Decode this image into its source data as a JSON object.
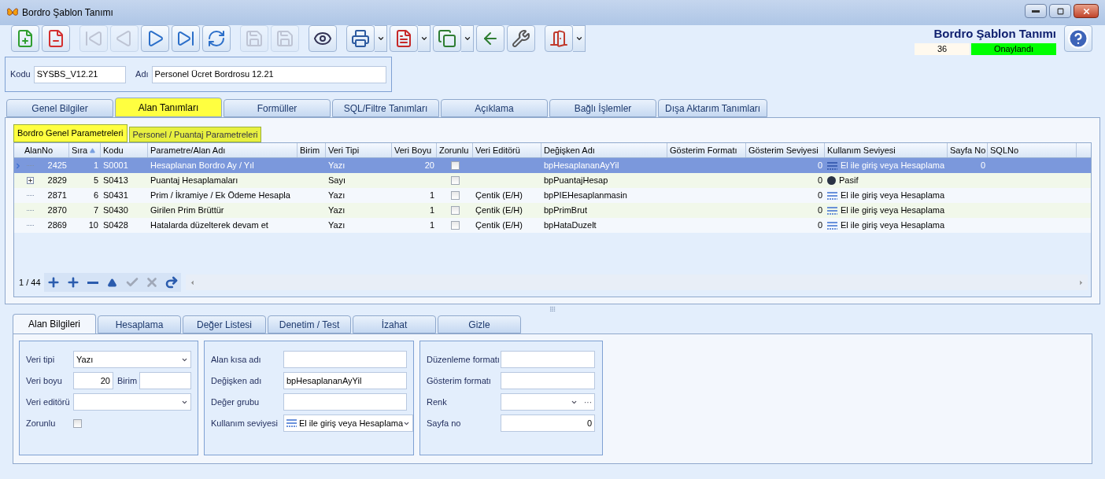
{
  "window": {
    "title": "Bordro Şablon Tanımı"
  },
  "toolbar": [
    {
      "kind": "new",
      "disabled": false,
      "dropdown": false
    },
    {
      "kind": "delete",
      "disabled": false,
      "dropdown": false
    },
    {
      "kind": "first",
      "disabled": true,
      "dropdown": false
    },
    {
      "kind": "prev",
      "disabled": true,
      "dropdown": false
    },
    {
      "kind": "next",
      "disabled": false,
      "dropdown": false
    },
    {
      "kind": "last",
      "disabled": false,
      "dropdown": false
    },
    {
      "kind": "refresh",
      "disabled": false,
      "dropdown": false
    },
    {
      "kind": "save",
      "disabled": true,
      "dropdown": false
    },
    {
      "kind": "cancel",
      "disabled": true,
      "dropdown": false
    },
    {
      "kind": "preview",
      "disabled": false,
      "dropdown": false
    },
    {
      "kind": "print",
      "disabled": false,
      "dropdown": true
    },
    {
      "kind": "pdf",
      "disabled": false,
      "dropdown": true
    },
    {
      "kind": "export",
      "disabled": false,
      "dropdown": true
    },
    {
      "kind": "import",
      "disabled": false,
      "dropdown": false
    },
    {
      "kind": "tools",
      "disabled": false,
      "dropdown": false
    },
    {
      "kind": "exit",
      "disabled": false,
      "dropdown": true
    }
  ],
  "header": {
    "title": "Bordro Şablon Tanımı",
    "number": "36",
    "status": "Onaylandı"
  },
  "form": {
    "kodu_label": "Kodu",
    "kodu": "SYSBS_V12.21",
    "adi_label": "Adı",
    "adi": "Personel Ücret Bordrosu 12.21"
  },
  "main_tabs": [
    {
      "label": "Genel Bilgiler",
      "selected": false
    },
    {
      "label": "Alan Tanımları",
      "selected": true
    },
    {
      "label": "Formüller",
      "selected": false
    },
    {
      "label": "SQL/Filtre Tanımları",
      "selected": false
    },
    {
      "label": "Açıklama",
      "selected": false
    },
    {
      "label": "Bağlı İşlemler",
      "selected": false
    },
    {
      "label": "Dışa Aktarım Tanımları",
      "selected": false
    }
  ],
  "sub_tabs": [
    {
      "label": "Bordro Genel Parametreleri",
      "selected": true
    },
    {
      "label": "Personel / Puantaj Parametreleri",
      "selected": false
    }
  ],
  "grid": {
    "columns": [
      "AlanNo",
      "Sıra",
      "Kodu",
      "Parametre/Alan Adı",
      "Birim",
      "Veri Tipi",
      "Veri Boyu",
      "Zorunlu",
      "Veri Editörü",
      "Değişken Adı",
      "Gösterim Formatı",
      "Gösterim Seviyesi",
      "Kullanım Seviyesi",
      "Sayfa No",
      "SQLNo"
    ],
    "rows": [
      {
        "selected": true,
        "expandable": false,
        "zorunlu": false,
        "cells": {
          "alan_no": "2425",
          "sira": "1",
          "kodu": "S0001",
          "name": "Hesaplanan Bordro Ay / Yıl",
          "veri_tipi": "Yazı",
          "veri_boyu": "20",
          "degisken": "bpHesaplananAyYil",
          "gosterim_seviyesi": "0",
          "kullanim": {
            "kind": "lines",
            "text": "El ile giriş veya Hesaplama"
          },
          "sayfa_no": "0"
        }
      },
      {
        "selected": false,
        "expandable": true,
        "zorunlu": false,
        "cells": {
          "alan_no": "2829",
          "sira": "5",
          "kodu": "S0413",
          "name": "Puantaj Hesaplamaları",
          "veri_tipi": "Sayı",
          "degisken": "bpPuantajHesap",
          "gosterim_seviyesi": "0",
          "kullanim": {
            "kind": "dot",
            "text": "Pasif"
          }
        }
      },
      {
        "selected": false,
        "expandable": false,
        "zorunlu": false,
        "cells": {
          "alan_no": "2871",
          "sira": "6",
          "kodu": "S0431",
          "name": "Prim / İkramiye / Ek Ödeme Hesapla",
          "veri_tipi": "Yazı",
          "veri_boyu": "1",
          "editor": "Çentik (E/H)",
          "degisken": "bpPIEHesaplanmasin",
          "gosterim_seviyesi": "0",
          "kullanim": {
            "kind": "lines",
            "text": "El ile giriş veya Hesaplama"
          }
        }
      },
      {
        "selected": false,
        "expandable": false,
        "zorunlu": false,
        "cells": {
          "alan_no": "2870",
          "sira": "7",
          "kodu": "S0430",
          "name": "Girilen Prim Brüttür",
          "veri_tipi": "Yazı",
          "veri_boyu": "1",
          "editor": "Çentik (E/H)",
          "degisken": "bpPrimBrut",
          "gosterim_seviyesi": "0",
          "kullanim": {
            "kind": "lines",
            "text": "El ile giriş veya Hesaplama"
          }
        }
      },
      {
        "selected": false,
        "expandable": false,
        "zorunlu": false,
        "cells": {
          "alan_no": "2869",
          "sira": "10",
          "kodu": "S0428",
          "name": "Hatalarda düzelterek devam et",
          "veri_tipi": "Yazı",
          "veri_boyu": "1",
          "editor": "Çentik (E/H)",
          "degisken": "bpHataDuzelt",
          "gosterim_seviyesi": "0",
          "kullanim": {
            "kind": "lines",
            "text": "El ile giriş veya Hesaplama"
          }
        }
      }
    ],
    "record_count": "1 / 44",
    "nav_buttons": [
      {
        "kind": "add",
        "disabled": false
      },
      {
        "kind": "add-child",
        "disabled": false
      },
      {
        "kind": "remove",
        "disabled": false
      },
      {
        "kind": "up",
        "disabled": false
      },
      {
        "kind": "confirm",
        "disabled": true
      },
      {
        "kind": "cancel",
        "disabled": true
      },
      {
        "kind": "redo",
        "disabled": false
      }
    ]
  },
  "detail_tabs": [
    {
      "label": "Alan Bilgileri",
      "selected": true
    },
    {
      "label": "Hesaplama",
      "selected": false
    },
    {
      "label": "Değer Listesi",
      "selected": false
    },
    {
      "label": "Denetim / Test",
      "selected": false
    },
    {
      "label": "İzahat",
      "selected": false
    },
    {
      "label": "Gizle",
      "selected": false
    }
  ],
  "detail": {
    "veri_tipi": {
      "label": "Veri tipi",
      "value": "Yazı"
    },
    "veri_boyu": {
      "label": "Veri boyu",
      "value": "20"
    },
    "birim": {
      "label": "Birim"
    },
    "veri_editoru": {
      "label": "Veri editörü"
    },
    "zorunlu": {
      "label": "Zorunlu",
      "checked": false
    },
    "alan_kisa_adi": {
      "label": "Alan kısa adı"
    },
    "degisken_adi": {
      "label": "Değişken adı",
      "value": "bpHesaplananAyYil"
    },
    "deger_grubu": {
      "label": "Değer grubu"
    },
    "kullanim_seviyesi": {
      "label": "Kullanım seviyesi",
      "value": "El ile giriş veya Hesaplama"
    },
    "duzenleme_formati": {
      "label": "Düzenleme formatı"
    },
    "gosterim_formati": {
      "label": "Gösterim formatı"
    },
    "renk": {
      "label": "Renk",
      "more": "···"
    },
    "sayfa_no": {
      "label": "Sayfa no",
      "value": "0"
    }
  }
}
